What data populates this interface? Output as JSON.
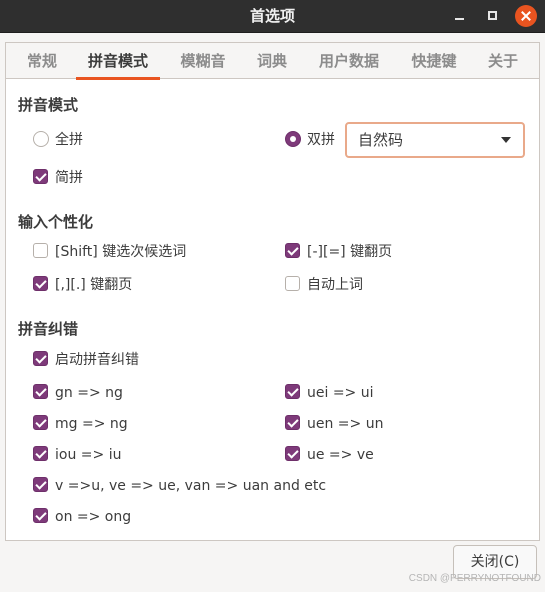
{
  "window": {
    "title": "首选项"
  },
  "tabs": [
    {
      "label": "常规"
    },
    {
      "label": "拼音模式"
    },
    {
      "label": "模糊音"
    },
    {
      "label": "词典"
    },
    {
      "label": "用户数据"
    },
    {
      "label": "快捷键"
    },
    {
      "label": "关于"
    }
  ],
  "active_tab": "拼音模式",
  "pinyin_mode": {
    "heading": "拼音模式",
    "full_pinyin": {
      "label": "全拼",
      "selected": false
    },
    "double_pinyin": {
      "label": "双拼",
      "selected": true
    },
    "scheme_combo": {
      "value": "自然码"
    },
    "simple_pinyin": {
      "label": "简拼",
      "checked": true
    }
  },
  "input_personalization": {
    "heading": "输入个性化",
    "shift_select": {
      "label": "[Shift] 键选次候选词",
      "checked": false
    },
    "minus_equal_page": {
      "label": "[-][=] 键翻页",
      "checked": true
    },
    "comma_period_page": {
      "label": "[,][.] 键翻页",
      "checked": true
    },
    "auto_commit": {
      "label": "自动上词",
      "checked": false
    }
  },
  "correction": {
    "heading": "拼音纠错",
    "enable": {
      "label": "启动拼音纠错",
      "checked": true
    },
    "gn_ng": {
      "label": "gn => ng",
      "checked": true
    },
    "uei_ui": {
      "label": "uei => ui",
      "checked": true
    },
    "mg_ng": {
      "label": "mg => ng",
      "checked": true
    },
    "uen_un": {
      "label": "uen => un",
      "checked": true
    },
    "iou_iu": {
      "label": "iou => iu",
      "checked": true
    },
    "ue_ve": {
      "label": "ue => ve",
      "checked": true
    },
    "v_u": {
      "label": "v =>u, ve => ue, van => uan and etc",
      "checked": true
    },
    "on_ong": {
      "label": "on => ong",
      "checked": true
    }
  },
  "footer": {
    "close_label": "关闭(C)"
  },
  "watermark": "CSDN @PERRYNOTFOUND",
  "colors": {
    "accent": "#e95420",
    "check": "#7e3a7a",
    "titlebar": "#2f2f2f"
  }
}
